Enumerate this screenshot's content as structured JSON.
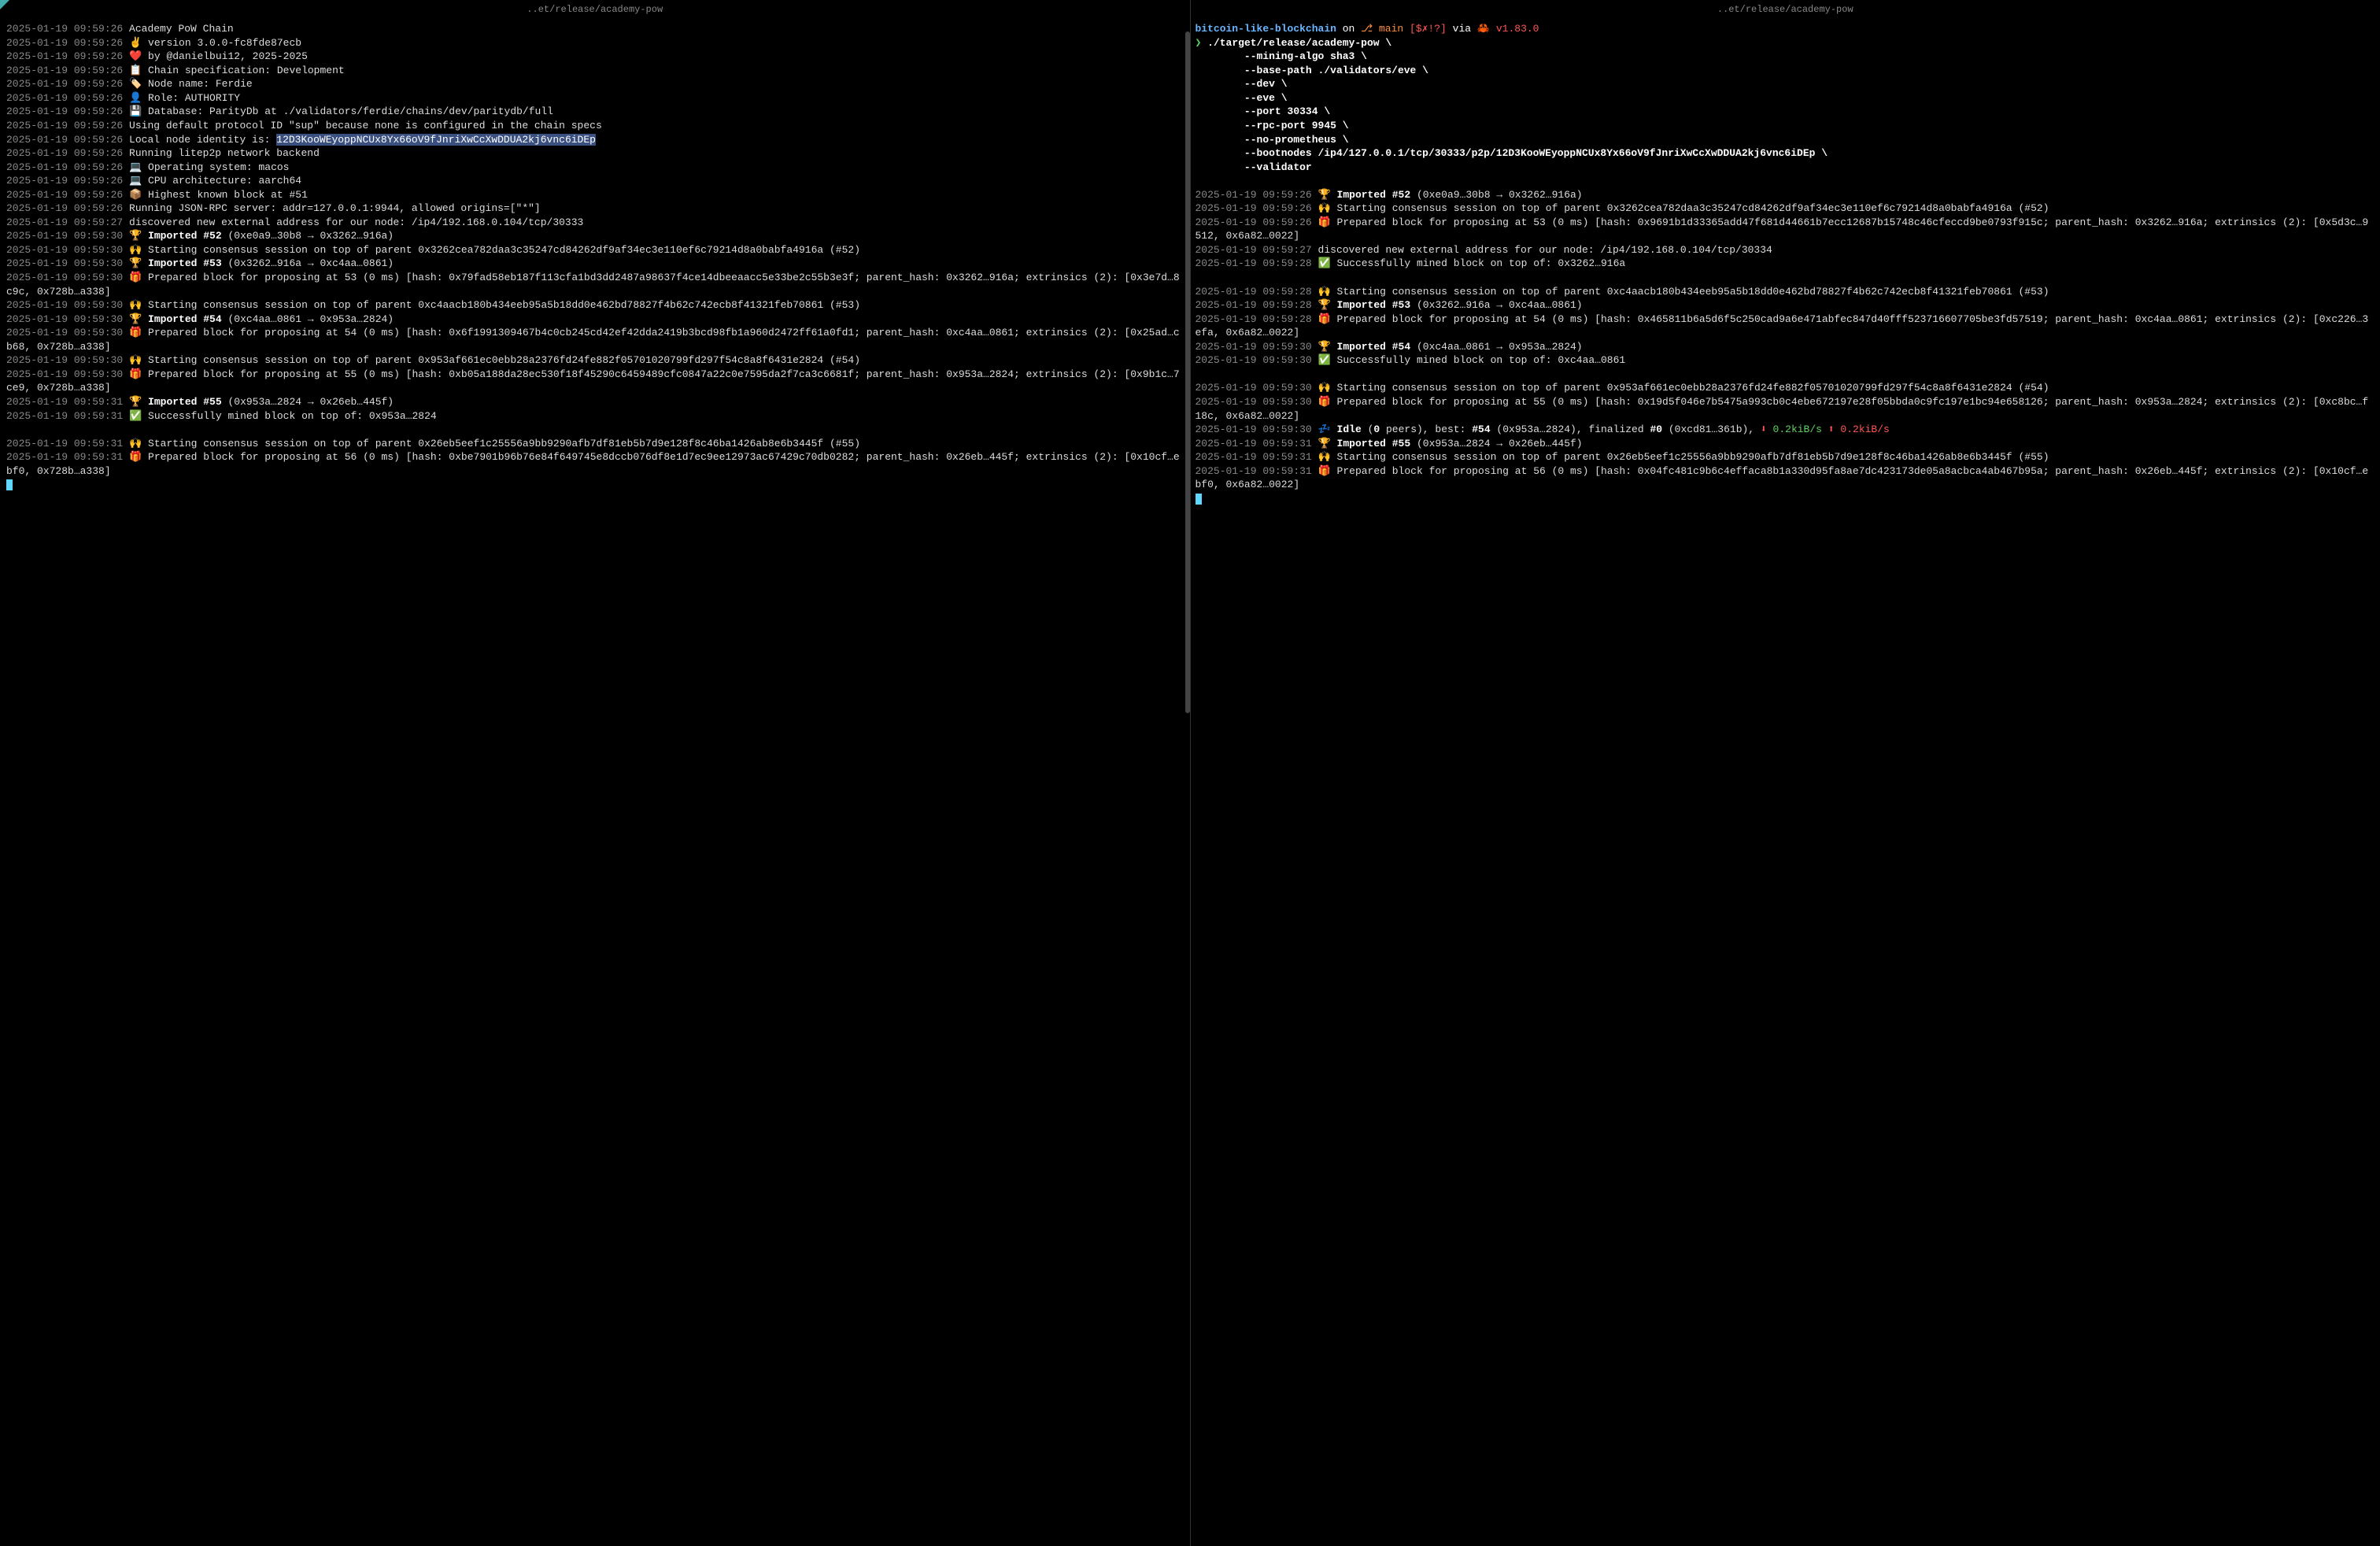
{
  "left": {
    "title": "..et/release/academy-pow",
    "lines": [
      {
        "ts": "2025-01-19 09:59:26",
        "icon": "",
        "text": "Academy PoW Chain"
      },
      {
        "ts": "2025-01-19 09:59:26",
        "icon": "✌️",
        "text": "version 3.0.0-fc8fde87ecb"
      },
      {
        "ts": "2025-01-19 09:59:26",
        "icon": "❤️",
        "text": "by @danielbui12, 2025-2025"
      },
      {
        "ts": "2025-01-19 09:59:26",
        "icon": "📋",
        "text": "Chain specification: Development"
      },
      {
        "ts": "2025-01-19 09:59:26",
        "icon": "🏷️",
        "text": "Node name: Ferdie"
      },
      {
        "ts": "2025-01-19 09:59:26",
        "icon": "👤",
        "text": "Role: AUTHORITY"
      },
      {
        "ts": "2025-01-19 09:59:26",
        "icon": "💾",
        "text": "Database: ParityDb at ./validators/ferdie/chains/dev/paritydb/full"
      },
      {
        "ts": "2025-01-19 09:59:26",
        "icon": "",
        "text": "Using default protocol ID \"sup\" because none is configured in the chain specs"
      },
      {
        "ts": "2025-01-19 09:59:26",
        "icon": "",
        "prefix": "Local node identity is: ",
        "highlight": "12D3KooWEyoppNCUx8Yx66oV9fJnriXwCcXwDDUA2kj6vnc6iDEp"
      },
      {
        "ts": "2025-01-19 09:59:26",
        "icon": "",
        "text": "Running litep2p network backend"
      },
      {
        "ts": "2025-01-19 09:59:26",
        "icon": "💻",
        "text": "Operating system: macos"
      },
      {
        "ts": "2025-01-19 09:59:26",
        "icon": "💻",
        "text": "CPU architecture: aarch64"
      },
      {
        "ts": "2025-01-19 09:59:26",
        "icon": "📦",
        "text": "Highest known block at #51"
      },
      {
        "ts": "2025-01-19 09:59:26",
        "icon": "",
        "text": "Running JSON-RPC server: addr=127.0.0.1:9944, allowed origins=[\"*\"]"
      },
      {
        "ts": "2025-01-19 09:59:27",
        "icon": "",
        "text": "discovered new external address for our node: /ip4/192.168.0.104/tcp/30333"
      },
      {
        "ts": "2025-01-19 09:59:30",
        "icon": "🏆",
        "bold": "Imported #52",
        "after": " (0xe0a9…30b8 → 0x3262…916a)"
      },
      {
        "ts": "2025-01-19 09:59:30",
        "icon": "🙌",
        "text": "Starting consensus session on top of parent 0x3262cea782daa3c35247cd84262df9af34ec3e110ef6c79214d8a0babfa4916a (#52)"
      },
      {
        "ts": "2025-01-19 09:59:30",
        "icon": "🏆",
        "bold": "Imported #53",
        "after": " (0x3262…916a → 0xc4aa…0861)"
      },
      {
        "ts": "2025-01-19 09:59:30",
        "icon": "🎁",
        "text": "Prepared block for proposing at 53 (0 ms) [hash: 0x79fad58eb187f113cfa1bd3dd2487a98637f4ce14dbeeaacc5e33be2c55b3e3f; parent_hash: 0x3262…916a; extrinsics (2): [0x3e7d…8c9c, 0x728b…a338]"
      },
      {
        "ts": "2025-01-19 09:59:30",
        "icon": "🙌",
        "text": "Starting consensus session on top of parent 0xc4aacb180b434eeb95a5b18dd0e462bd78827f4b62c742ecb8f41321feb70861 (#53)"
      },
      {
        "ts": "2025-01-19 09:59:30",
        "icon": "🏆",
        "bold": "Imported #54",
        "after": " (0xc4aa…0861 → 0x953a…2824)"
      },
      {
        "ts": "2025-01-19 09:59:30",
        "icon": "🎁",
        "text": "Prepared block for proposing at 54 (0 ms) [hash: 0x6f1991309467b4c0cb245cd42ef42dda2419b3bcd98fb1a960d2472ff61a0fd1; parent_hash: 0xc4aa…0861; extrinsics (2): [0x25ad…cb68, 0x728b…a338]"
      },
      {
        "ts": "2025-01-19 09:59:30",
        "icon": "🙌",
        "text": "Starting consensus session on top of parent 0x953af661ec0ebb28a2376fd24fe882f05701020799fd297f54c8a8f6431e2824 (#54)"
      },
      {
        "ts": "2025-01-19 09:59:30",
        "icon": "🎁",
        "text": "Prepared block for proposing at 55 (0 ms) [hash: 0xb05a188da28ec530f18f45290c6459489cfc0847a22c0e7595da2f7ca3c6681f; parent_hash: 0x953a…2824; extrinsics (2): [0x9b1c…7ce9, 0x728b…a338]"
      },
      {
        "ts": "2025-01-19 09:59:31",
        "icon": "🏆",
        "bold": "Imported #55",
        "after": " (0x953a…2824 → 0x26eb…445f)"
      },
      {
        "ts": "2025-01-19 09:59:31",
        "icon": "✅",
        "text": "Successfully mined block on top of: 0x953a…2824"
      },
      {
        "ts": "",
        "icon": "",
        "text": ""
      },
      {
        "ts": "2025-01-19 09:59:31",
        "icon": "🙌",
        "text": "Starting consensus session on top of parent 0x26eb5eef1c25556a9bb9290afb7df81eb5b7d9e128f8c46ba1426ab8e6b3445f (#55)"
      },
      {
        "ts": "2025-01-19 09:59:31",
        "icon": "🎁",
        "text": "Prepared block for proposing at 56 (0 ms) [hash: 0xbe7901b96b76e84f649745e8dccb076df8e1d7ec9ee12973ac67429c70db0282; parent_hash: 0x26eb…445f; extrinsics (2): [0x10cf…ebf0, 0x728b…a338]"
      }
    ]
  },
  "right": {
    "title": "..et/release/academy-pow",
    "prompt": {
      "project": "bitcoin-like-blockchain",
      "on": "on",
      "branch_icon": "⎇",
      "branch": "main",
      "status": "[$✗!?]",
      "via": "via",
      "crab": "🦀",
      "rust_ver": "v1.83.0",
      "cmd": "./target/release/academy-pow \\",
      "args": [
        "--mining-algo sha3 \\",
        "--base-path ./validators/eve \\",
        "--dev \\",
        "--eve \\",
        "--port 30334 \\",
        "--rpc-port 9945 \\",
        "--no-prometheus \\",
        "--bootnodes /ip4/127.0.0.1/tcp/30333/p2p/12D3KooWEyoppNCUx8Yx66oV9fJnriXwCcXwDDUA2kj6vnc6iDEp \\",
        "--validator"
      ]
    },
    "lines": [
      {
        "ts": "2025-01-19 09:59:26",
        "icon": "🏆",
        "bold": "Imported #52",
        "after": " (0xe0a9…30b8 → 0x3262…916a)"
      },
      {
        "ts": "2025-01-19 09:59:26",
        "icon": "🙌",
        "text": "Starting consensus session on top of parent 0x3262cea782daa3c35247cd84262df9af34ec3e110ef6c79214d8a0babfa4916a (#52)"
      },
      {
        "ts": "2025-01-19 09:59:26",
        "icon": "🎁",
        "text": "Prepared block for proposing at 53 (0 ms) [hash: 0x9691b1d33365add47f681d44661b7ecc12687b15748c46cfeccd9be0793f915c; parent_hash: 0x3262…916a; extrinsics (2): [0x5d3c…9512, 0x6a82…0022]"
      },
      {
        "ts": "2025-01-19 09:59:27",
        "icon": "",
        "text": "discovered new external address for our node: /ip4/192.168.0.104/tcp/30334"
      },
      {
        "ts": "2025-01-19 09:59:28",
        "icon": "✅",
        "text": "Successfully mined block on top of: 0x3262…916a"
      },
      {
        "ts": "",
        "icon": "",
        "text": ""
      },
      {
        "ts": "2025-01-19 09:59:28",
        "icon": "🙌",
        "text": "Starting consensus session on top of parent 0xc4aacb180b434eeb95a5b18dd0e462bd78827f4b62c742ecb8f41321feb70861 (#53)"
      },
      {
        "ts": "2025-01-19 09:59:28",
        "icon": "🏆",
        "bold": "Imported #53",
        "after": " (0x3262…916a → 0xc4aa…0861)"
      },
      {
        "ts": "2025-01-19 09:59:28",
        "icon": "🎁",
        "text": "Prepared block for proposing at 54 (0 ms) [hash: 0x465811b6a5d6f5c250cad9a6e471abfec847d40fff523716607705be3fd57519; parent_hash: 0xc4aa…0861; extrinsics (2): [0xc226…3efa, 0x6a82…0022]"
      },
      {
        "ts": "2025-01-19 09:59:30",
        "icon": "🏆",
        "bold": "Imported #54",
        "after": " (0xc4aa…0861 → 0x953a…2824)"
      },
      {
        "ts": "2025-01-19 09:59:30",
        "icon": "✅",
        "text": "Successfully mined block on top of: 0xc4aa…0861"
      },
      {
        "ts": "",
        "icon": "",
        "text": ""
      },
      {
        "ts": "2025-01-19 09:59:30",
        "icon": "🙌",
        "text": "Starting consensus session on top of parent 0x953af661ec0ebb28a2376fd24fe882f05701020799fd297f54c8a8f6431e2824 (#54)"
      },
      {
        "ts": "2025-01-19 09:59:30",
        "icon": "🎁",
        "text": "Prepared block for proposing at 55 (0 ms) [hash: 0x19d5f046e7b5475a993cb0c4ebe672197e28f05bbda0c9fc197e1bc94e658126; parent_hash: 0x953a…2824; extrinsics (2): [0xc8bc…f18c, 0x6a82…0022]"
      },
      {
        "ts": "2025-01-19 09:59:30",
        "icon": "💤",
        "idle": true
      },
      {
        "ts": "2025-01-19 09:59:31",
        "icon": "🏆",
        "bold": "Imported #55",
        "after": " (0x953a…2824 → 0x26eb…445f)"
      },
      {
        "ts": "2025-01-19 09:59:31",
        "icon": "🙌",
        "text": "Starting consensus session on top of parent 0x26eb5eef1c25556a9bb9290afb7df81eb5b7d9e128f8c46ba1426ab8e6b3445f (#55)"
      },
      {
        "ts": "2025-01-19 09:59:31",
        "icon": "🎁",
        "text": "Prepared block for proposing at 56 (0 ms) [hash: 0x04fc481c9b6c4effaca8b1a330d95fa8ae7dc423173de05a8acbca4ab467b95a; parent_hash: 0x26eb…445f; extrinsics (2): [0x10cf…ebf0, 0x6a82…0022]"
      }
    ],
    "idle": {
      "label": "Idle",
      "peers_open": "(",
      "peers_num": "0",
      "peers_close": " peers), best: ",
      "best_num": "#54",
      "best_hash": " (0x953a…2824), finalized ",
      "fin_num": "#0",
      "fin_hash": " (0xcd81…361b), ",
      "down_arrow": "⬇",
      "down": "0.2kiB/s",
      "up_arrow": "⬆",
      "up": "0.2kiB/s"
    }
  }
}
